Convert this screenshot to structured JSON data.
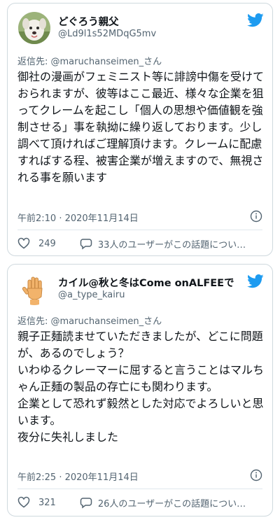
{
  "tweets": [
    {
      "display_name": "どぐろう親父",
      "handle": "@Ld9l1s52MDqG5mv",
      "reply_prefix": "返信先: ",
      "reply_to": "@maruchanseimen_さん",
      "body": "御社の漫画がフェミニスト等に誹謗中傷を受けておられますが、彼等はここ最近、様々な企業を狙ってクレームを起こし「個人の思想や価値観を強制させる」事を執拗に繰り返しております。少し調べて頂ければご理解頂けます。クレームに配慮すればする程、被害企業が増えますので、無視される事を願います",
      "timestamp": "午前2:10 · 2020年11月14日",
      "likes": "249",
      "conversation": "33人のユーザーがこの話題につい…",
      "avatar_icon": "dog-avatar-icon"
    },
    {
      "display_name": "カイル@秋と冬はCome onALFEEで",
      "handle": "@a_type_kairu",
      "reply_prefix": "返信先: ",
      "reply_to": "@maruchanseimen_さん",
      "body": "親子正麺読ませていただきましたが、どこに問題が、あるのでしょう？\nいわゆるクレーマーに屈すると言うことはマルちゃん正麺の製品の存亡にも関わります。\n企業として恐れず毅然とした対応でよろしいと思います。\n夜分に失礼しました",
      "timestamp": "午前2:25 · 2020年11月14日",
      "likes": "321",
      "conversation": "26人のユーザーがこの話題につい…",
      "avatar_icon": "raised-hand-avatar-icon"
    }
  ],
  "colors": {
    "brand_blue": "#1d9bf0",
    "secondary_text": "#536471",
    "border": "#cfd9de"
  }
}
